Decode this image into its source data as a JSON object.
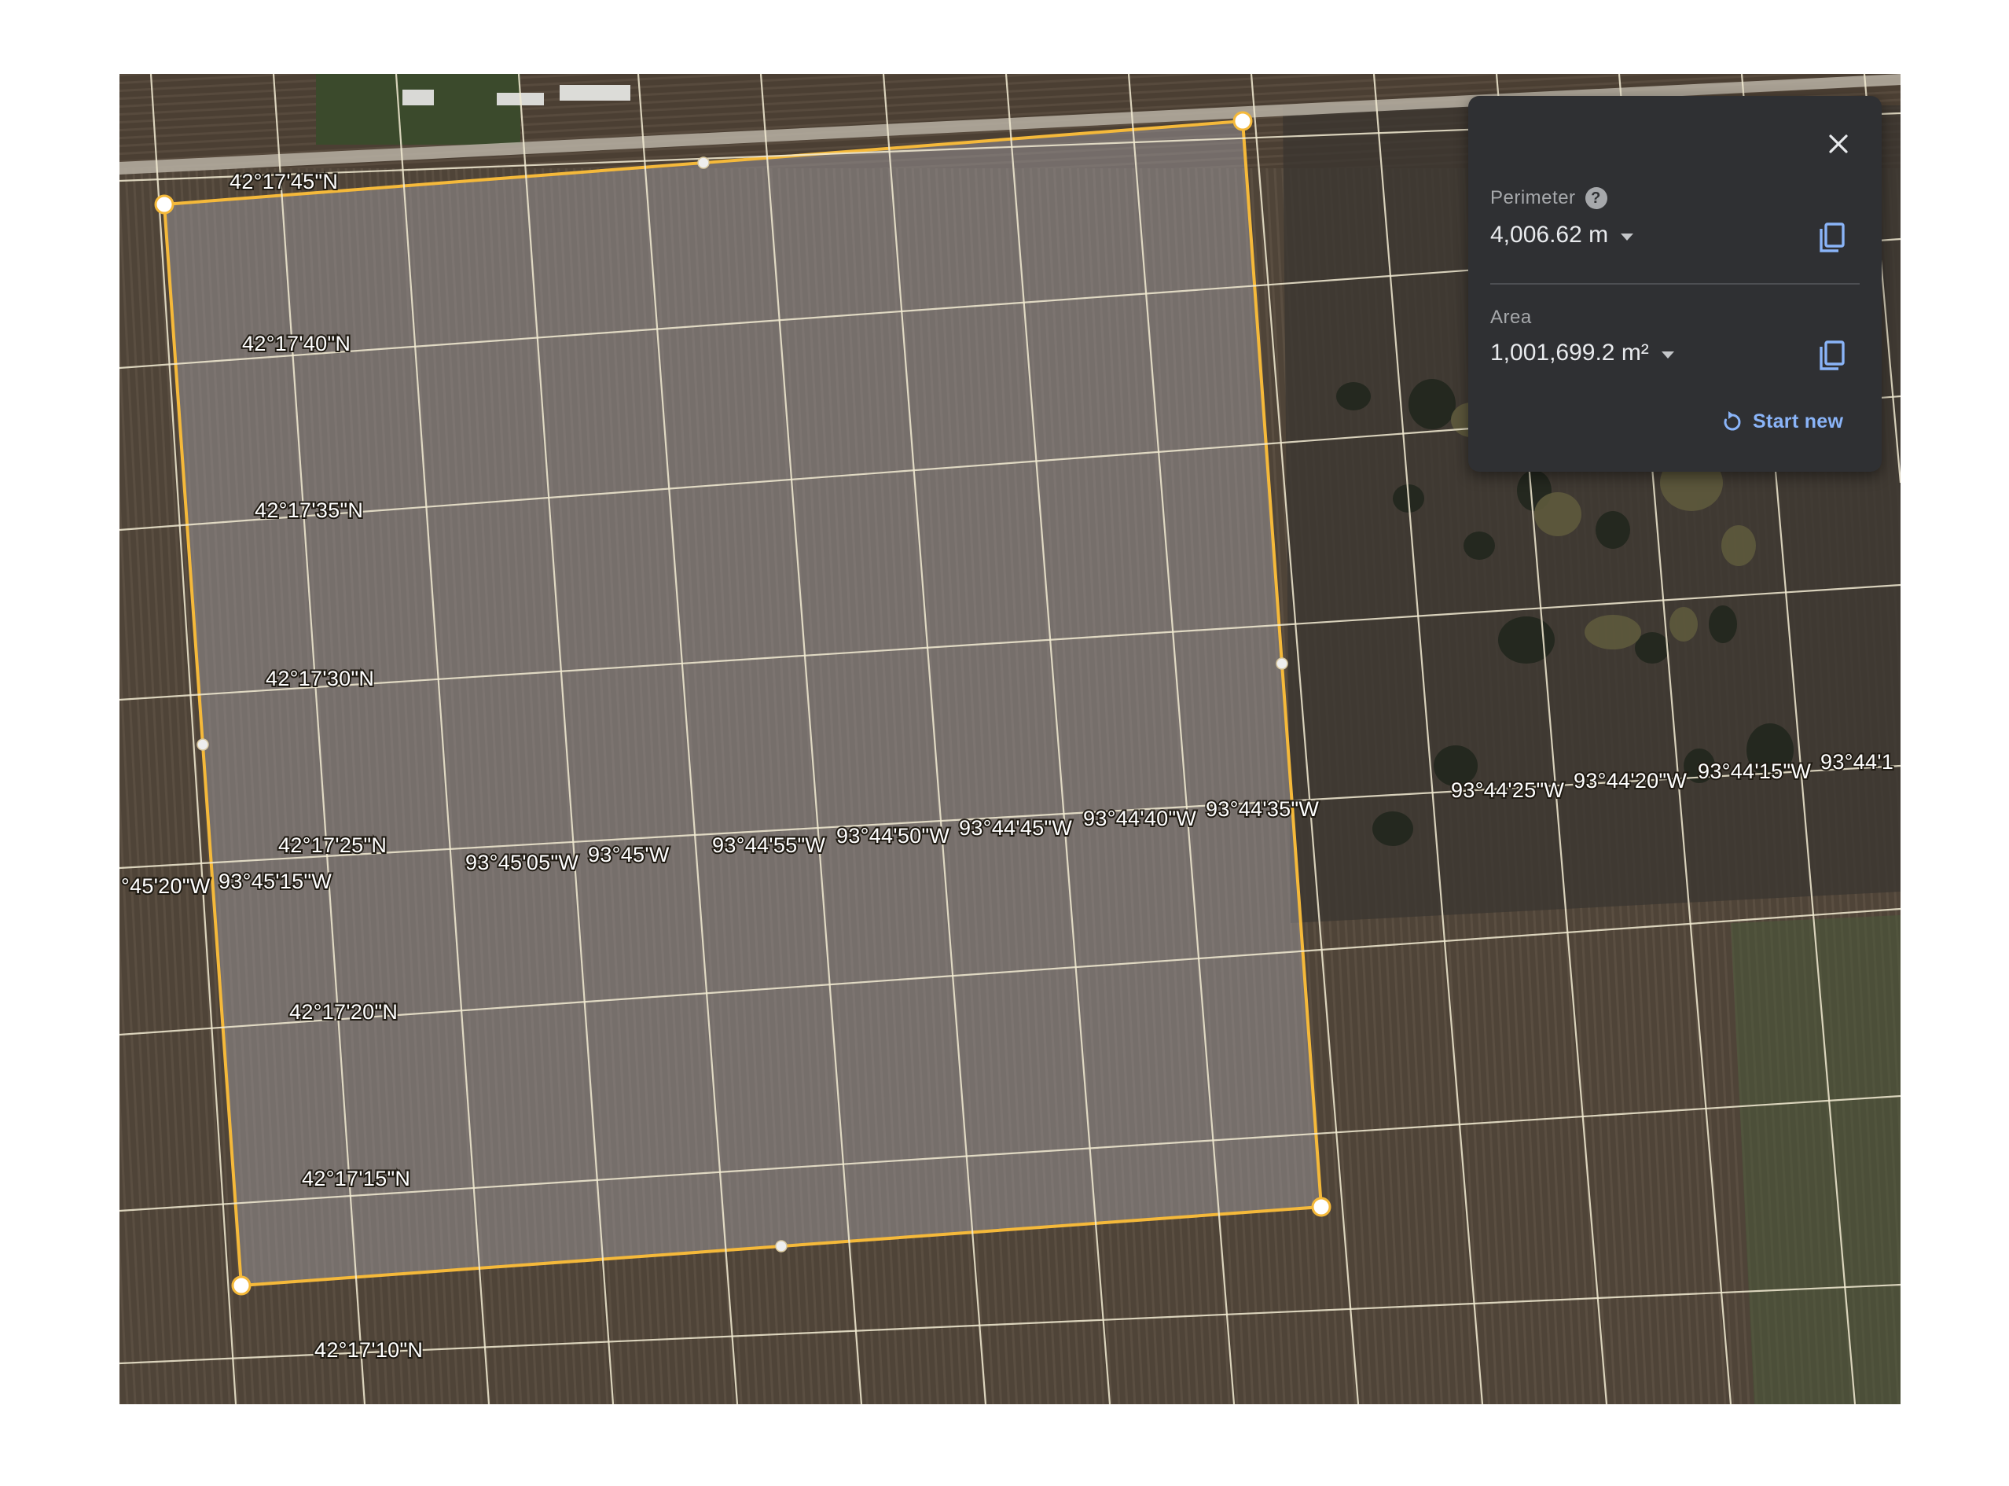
{
  "map": {
    "grid_labels": {
      "latitude": [
        "42°17'45\"N",
        "42°17'40\"N",
        "42°17'35\"N",
        "42°17'30\"N",
        "42°17'25\"N",
        "42°17'20\"N",
        "42°17'15\"N",
        "42°17'10\"N"
      ],
      "longitude": [
        "°45'20\"W",
        "93°45'15\"W",
        "93°45'05\"W",
        "93°45'W",
        "93°44'55\"W",
        "93°44'50\"W",
        "93°44'45\"W",
        "93°44'40\"W",
        "93°44'35\"W",
        "93°44'25\"W",
        "93°44'20\"W",
        "93°44'15\"W",
        "93°44'1"
      ]
    },
    "polygon": {
      "outline_color": "#f5b93a",
      "fill_color": "#9e9aa0",
      "vertex_count": 4,
      "midpoint_count": 4
    },
    "colors": {
      "field": "#4f4438",
      "grid": "#f3ecd3",
      "road": "#b9b2a4",
      "vegetation": "#2f3a22"
    }
  },
  "measure_panel": {
    "close_icon": "close-icon",
    "perimeter": {
      "label": "Perimeter",
      "help_icon": "help-icon",
      "help_glyph": "?",
      "value": "4,006.62 m",
      "copy_icon": "copy-icon"
    },
    "area": {
      "label": "Area",
      "value": "1,001,699.2 m²",
      "copy_icon": "copy-icon"
    },
    "start_new": {
      "label": "Start new",
      "icon": "refresh-icon"
    },
    "colors": {
      "background": "#2f3033",
      "text": "#e8eaed",
      "label": "#a6a8ab",
      "accent": "#8ab4f8"
    }
  }
}
